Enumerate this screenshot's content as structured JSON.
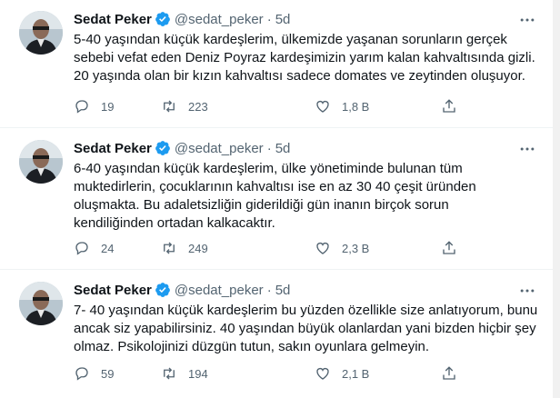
{
  "colors": {
    "accent": "#1d9bf0",
    "muted": "#536471",
    "text": "#0f1419",
    "border": "#eff3f4"
  },
  "icons": {
    "verified": "verified-badge-icon",
    "more": "more-dots-icon",
    "reply": "reply-icon",
    "retweet": "retweet-icon",
    "like": "heart-icon",
    "share": "share-icon"
  },
  "tweets": [
    {
      "name": "Sedat Peker",
      "handle": "@sedat_peker",
      "sep": "·",
      "time": "5d",
      "line1": "5-40 yaşından küçük kardeşlerim, ülkemizde yaşanan sorunların gerçek",
      "line2": "sebebi vefat eden Deniz Poyraz kardeşimizin yarım kalan kahvaltısında gizli.",
      "line3": "20 yaşında olan bir kızın kahvaltısı sadece domates ve zeytinden oluşuyor.",
      "line4": "",
      "replies": "19",
      "retweets": "223",
      "likes": "1,8 B"
    },
    {
      "name": "Sedat Peker",
      "handle": "@sedat_peker",
      "sep": "·",
      "time": "5d",
      "line1": "6-40 yaşından küçük kardeşlerim, ülke yönetiminde bulunan tüm",
      "line2": "muktedirlerin, çocuklarının kahvaltısı ise en az 30 40 çeşit üründen",
      "line3": "oluşmakta. Bu adaletsizliğin giderildiği gün inanın birçok sorun",
      "line4": "kendiliğinden ortadan kalkacaktır.",
      "replies": "24",
      "retweets": "249",
      "likes": "2,3 B"
    },
    {
      "name": "Sedat Peker",
      "handle": "@sedat_peker",
      "sep": "·",
      "time": "5d",
      "line1": "7- 40 yaşından küçük kardeşlerim bu yüzden özellikle size anlatıyorum, bunu",
      "line2": "ancak siz yapabilirsiniz. 40 yaşından büyük olanlardan yani bizden hiçbir şey",
      "line3": "olmaz. Psikolojinizi düzgün tutun, sakın oyunlara gelmeyin.",
      "line4": "",
      "replies": "59",
      "retweets": "194",
      "likes": "2,1 B"
    }
  ]
}
